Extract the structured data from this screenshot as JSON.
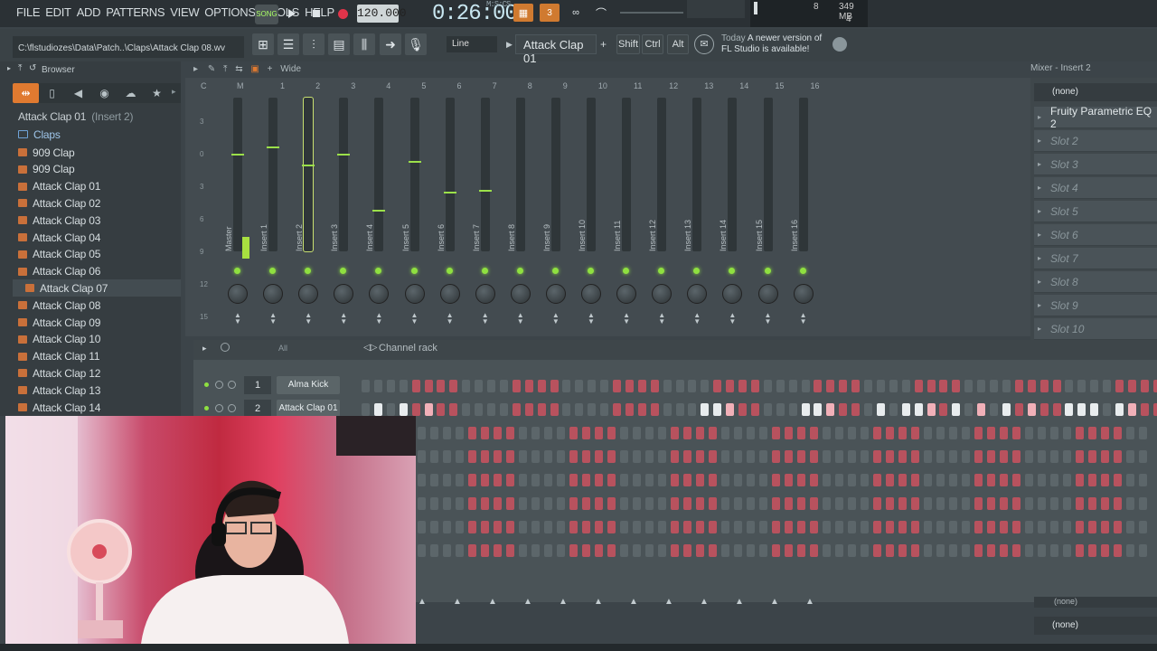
{
  "menu": [
    "FILE",
    "EDIT",
    "ADD",
    "PATTERNS",
    "VIEW",
    "OPTIONS",
    "TOOLS",
    "HELP"
  ],
  "transport": {
    "song_label": "SONG",
    "tempo": "120.000",
    "time": "0:26:00",
    "time_label": "M:S:CS"
  },
  "memory": {
    "mb": "349 MB",
    "v1": "8",
    "v2": "4"
  },
  "path": "C:\\flstudiozes\\Data\\Patch..\\Claps\\Attack Clap 08.wv",
  "snap": "Line",
  "pattern": "Attack Clap 01",
  "keys": [
    "Shift",
    "Ctrl",
    "Alt"
  ],
  "news": {
    "today": "Today",
    "text1": "A newer version of",
    "text2": "FL Studio is available!"
  },
  "browser": {
    "title": "Browser",
    "header_item": "Attack Clap 01",
    "header_sub": "(Insert 2)",
    "folder": "Claps",
    "items": [
      "909 Clap",
      "909 Clap",
      "Attack Clap 01",
      "Attack Clap 02",
      "Attack Clap 03",
      "Attack Clap 04",
      "Attack Clap 05",
      "Attack Clap 06",
      "Attack Clap 07",
      "Attack Clap 08",
      "Attack Clap 09",
      "Attack Clap 10",
      "Attack Clap 11",
      "Attack Clap 12",
      "Attack Clap 13",
      "Attack Clap 14"
    ],
    "selected_index": 8
  },
  "mixer": {
    "title": "Mixer - Insert 2",
    "view": "Wide",
    "numbers": [
      "C",
      "M",
      "1",
      "2",
      "3",
      "4",
      "5",
      "6",
      "7",
      "8",
      "9",
      "10",
      "11",
      "12",
      "13",
      "14",
      "15",
      "16"
    ],
    "strips": [
      "Master",
      "Insert 1",
      "Insert 2",
      "Insert 3",
      "Insert 4",
      "Insert 5",
      "Insert 6",
      "Insert 7",
      "Insert 8",
      "Insert 9",
      "Insert 10",
      "Insert 11",
      "Insert 12",
      "Insert 13",
      "Insert 14",
      "Insert 15",
      "Insert 16"
    ],
    "db_scale": [
      "3",
      "0",
      "3",
      "6",
      "9",
      "12",
      "15"
    ],
    "selected": "Insert 2"
  },
  "inserts": {
    "input": "(none)",
    "slots": [
      "Fruity Parametric EQ 2",
      "Slot 2",
      "Slot 3",
      "Slot 4",
      "Slot 5",
      "Slot 6",
      "Slot 7",
      "Slot 8",
      "Slot 9",
      "Slot 10"
    ],
    "output": "(none)",
    "output2": "(none)"
  },
  "rack": {
    "title": "Channel rack",
    "filter": "All",
    "channels": [
      {
        "num": "1",
        "name": "Alma Kick"
      },
      {
        "num": "2",
        "name": "Attack Clap 01"
      }
    ]
  },
  "colors": {
    "accent": "#e07a30",
    "led": "#8fe040",
    "pad_red": "#b8525e",
    "pad_gray": "#5c666a",
    "pad_lit": "#e8ecee"
  }
}
